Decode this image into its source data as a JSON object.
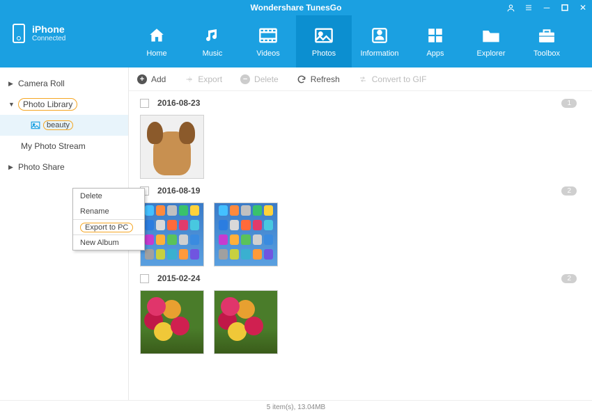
{
  "window": {
    "title": "Wondershare TunesGo"
  },
  "device": {
    "name": "iPhone",
    "status": "Connected"
  },
  "nav": {
    "home": "Home",
    "music": "Music",
    "videos": "Videos",
    "photos": "Photos",
    "information": "Information",
    "apps": "Apps",
    "explorer": "Explorer",
    "toolbox": "Toolbox"
  },
  "sidebar": {
    "camera_roll": "Camera Roll",
    "photo_library": "Photo Library",
    "beauty": "beauty",
    "my_photo_stream": "My Photo Stream",
    "photo_share": "Photo Share"
  },
  "context_menu": {
    "delete": "Delete",
    "rename": "Rename",
    "export_pc": "Export to PC",
    "new_album": "New Album"
  },
  "toolbar": {
    "add": "Add",
    "export": "Export",
    "delete": "Delete",
    "refresh": "Refresh",
    "convert": "Convert to GIF"
  },
  "groups": [
    {
      "date": "2016-08-23",
      "count": "1"
    },
    {
      "date": "2016-08-19",
      "count": "2"
    },
    {
      "date": "2015-02-24",
      "count": "2"
    }
  ],
  "status": "5 item(s), 13.04MB",
  "phone_icon_colors": [
    [
      "#44c0ff",
      "#ff8a3d",
      "#c0c0c0",
      "#39c26b",
      "#ffd23a"
    ],
    [
      "#2b7de0",
      "#d9d9d9",
      "#ff6a3a",
      "#e23b6b",
      "#48c8e0"
    ],
    [
      "#c63bd0",
      "#ffb03a",
      "#5ac25a",
      "#d0d0d0",
      "#3a8be0"
    ],
    [
      "#a0a0a0",
      "#c8d040",
      "#3ab0d0",
      "#ff9a3a",
      "#7055e0"
    ]
  ]
}
